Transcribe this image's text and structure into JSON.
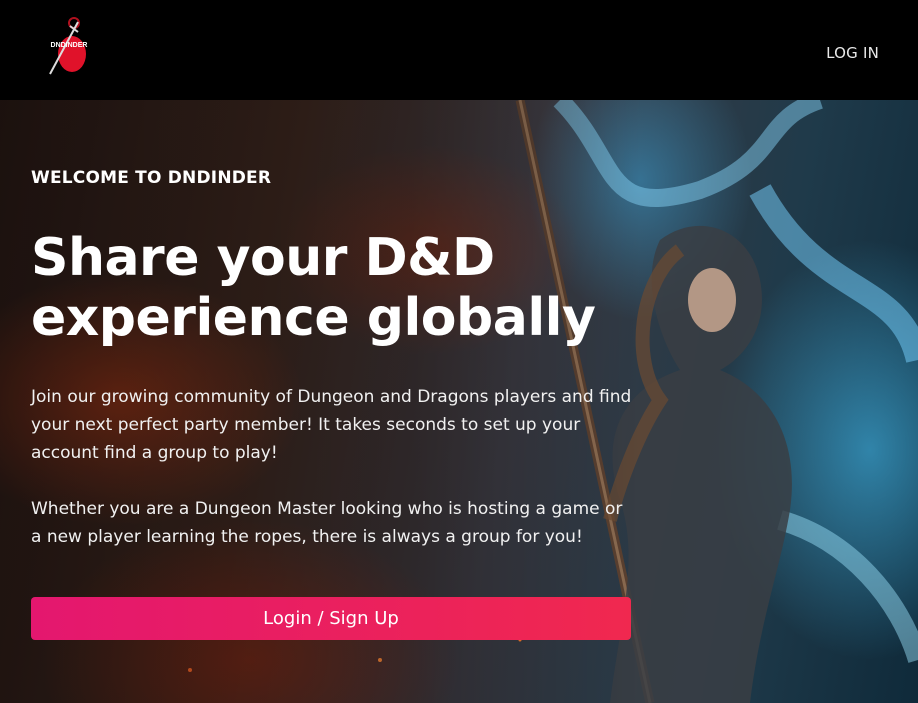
{
  "nav": {
    "logo_text": "DNDINDER",
    "login_label": "LOG IN"
  },
  "hero": {
    "eyebrow": "WELCOME TO DNDINDER",
    "headline": "Share your D&D experience globally",
    "paragraph_1": "Join our growing community of Dungeon and Dragons players and find your next perfect party member! It takes seconds to set up your account find a group to play!",
    "paragraph_2": "Whether you are a Dungeon Master looking who is hosting a game or a new player learning the ropes, there is always a group for you!",
    "cta_label": "Login / Sign Up"
  },
  "colors": {
    "nav_background": "#000000",
    "cta_gradient_start": "#e4176f",
    "cta_gradient_end": "#f0284f",
    "logo_red": "#e0122a"
  }
}
